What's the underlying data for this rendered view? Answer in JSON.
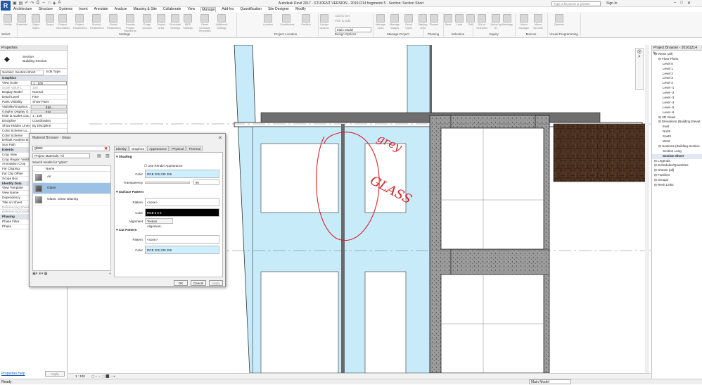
{
  "window": {
    "title": "Autodesk Revit 2017 - STUDENT VERSION -   20161214 fragments 5 - Section: Section Short",
    "search_placeholder": "Type a keyword or phrase",
    "signin": "Sign In"
  },
  "app_button": "R",
  "ribbon": {
    "tabs": [
      "Architecture",
      "Structure",
      "Systems",
      "Insert",
      "Annotate",
      "Analyze",
      "Massing & Site",
      "Collaborate",
      "View",
      "Manage",
      "Add-Ins",
      "Quantification",
      "Site Designer",
      "Modify"
    ],
    "active_tab": "Manage",
    "buttons": [
      "Modify",
      "Materials",
      "Object Styles",
      "Snaps",
      "Project Information",
      "Project Parameters",
      "Shared Parameters",
      "Global Parameters",
      "Transfer Project Standards",
      "Purge Unused",
      "Project Units",
      "Structural Settings",
      "MEP Settings",
      "Panel Schedule Templates",
      "Additional Settings",
      "Location",
      "Coordinates",
      "Position",
      "Design Options",
      "Main Model",
      "Manage Links",
      "Manage Images",
      "Decal Types",
      "Starting View",
      "Phases",
      "Save",
      "Load",
      "Edit",
      "IDs of Selection",
      "Select by ID",
      "Warnings",
      "Macro Manager",
      "Macro Security",
      "Dynamo"
    ],
    "design_option_items": [
      "Add to Set",
      "Pick to Edit",
      "Main Model"
    ],
    "panels": [
      "Select",
      "Settings",
      "Project Location",
      "Design Options",
      "Manage Project",
      "Phasing",
      "Selection",
      "Inquiry",
      "Macros",
      "Visual Programming"
    ]
  },
  "properties": {
    "title": "Properties",
    "type_name": "Section",
    "type_sub": "Building Section",
    "selector": "Section: Section Short",
    "edit_type": "Edit Type",
    "rows": [
      {
        "k": "Graphics",
        "v": "",
        "cat": true
      },
      {
        "k": "View Scale",
        "v": "1 : 100"
      },
      {
        "k": "Scale Value  1:",
        "v": "100",
        "dim": true
      },
      {
        "k": "Display Model",
        "v": "Normal"
      },
      {
        "k": "Detail Level",
        "v": "Fine"
      },
      {
        "k": "Parts Visibility",
        "v": "Show Parts"
      },
      {
        "k": "Visibility/Graphics...",
        "v": "Edit..."
      },
      {
        "k": "Graphic Display O...",
        "v": "Edit..."
      },
      {
        "k": "Hide at scales coa...",
        "v": "1 : 100"
      },
      {
        "k": "Discipline",
        "v": "Coordination"
      },
      {
        "k": "Show Hidden Lines",
        "v": "By Discipline"
      },
      {
        "k": "Color Scheme Lo...",
        "v": ""
      },
      {
        "k": "Color Scheme",
        "v": ""
      },
      {
        "k": "Default Analysis D...",
        "v": ""
      },
      {
        "k": "Sun Path",
        "v": ""
      },
      {
        "k": "Extents",
        "v": "",
        "cat": true
      },
      {
        "k": "Crop View",
        "v": ""
      },
      {
        "k": "Crop Region Visible",
        "v": ""
      },
      {
        "k": "Annotation Crop",
        "v": ""
      },
      {
        "k": "Far Clipping",
        "v": ""
      },
      {
        "k": "Far Clip Offset",
        "v": ""
      },
      {
        "k": "Scope Box",
        "v": ""
      },
      {
        "k": "Identity Data",
        "v": "",
        "cat": true
      },
      {
        "k": "View Template",
        "v": ""
      },
      {
        "k": "View Name",
        "v": ""
      },
      {
        "k": "Dependency",
        "v": ""
      },
      {
        "k": "Title on Sheet",
        "v": ""
      },
      {
        "k": "Referencing Sheet",
        "v": "",
        "dim": true
      },
      {
        "k": "Referencing Detail",
        "v": "",
        "dim": true
      },
      {
        "k": "Phasing",
        "v": "",
        "cat": true
      },
      {
        "k": "Phase Filter",
        "v": ""
      },
      {
        "k": "Phase",
        "v": ""
      }
    ],
    "help_link": "Properties help",
    "apply": "Apply"
  },
  "browser": {
    "title": "Project Browser - 20161214 fr...",
    "items": [
      {
        "t": "Views (all)",
        "d": 0
      },
      {
        "t": "Floor Plans",
        "d": 1
      },
      {
        "t": "Level  0",
        "d": 2
      },
      {
        "t": "Level  1",
        "d": 2
      },
      {
        "t": "Level  2",
        "d": 2
      },
      {
        "t": "Level  3",
        "d": 2
      },
      {
        "t": "Level  4",
        "d": 2
      },
      {
        "t": "Level -1",
        "d": 2
      },
      {
        "t": "Level -2",
        "d": 2
      },
      {
        "t": "Level -3",
        "d": 2
      },
      {
        "t": "Level -4",
        "d": 2
      },
      {
        "t": "Level -5",
        "d": 2
      },
      {
        "t": "Level -6",
        "d": 2
      },
      {
        "t": "3D Views",
        "d": 1
      },
      {
        "t": "Elevations (Building Elevat",
        "d": 1
      },
      {
        "t": "East",
        "d": 2
      },
      {
        "t": "North",
        "d": 2
      },
      {
        "t": "South",
        "d": 2
      },
      {
        "t": "West",
        "d": 2
      },
      {
        "t": "Sections (Building Section",
        "d": 1
      },
      {
        "t": "Section Long",
        "d": 2
      },
      {
        "t": "Section Short",
        "d": 2,
        "sel": true
      },
      {
        "t": "Legends",
        "d": 0
      },
      {
        "t": "Schedules/Quantities",
        "d": 0
      },
      {
        "t": "Sheets (all)",
        "d": 0
      },
      {
        "t": "Families",
        "d": 0
      },
      {
        "t": "Groups",
        "d": 0
      },
      {
        "t": "Revit Links",
        "d": 0
      }
    ]
  },
  "material_browser": {
    "title": "Material Browser - Glass",
    "search_value": "glass",
    "filter": "Project Materials: All",
    "results_label": "Search results for \"glass\"",
    "column": "Name",
    "items": [
      {
        "name": "Air",
        "sel": false
      },
      {
        "name": "Glass",
        "sel": true
      },
      {
        "name": "Glass, Clear Glazing",
        "sel": false
      }
    ],
    "tabs": [
      "Identity",
      "Graphics",
      "Appearance",
      "Physical",
      "Thermal"
    ],
    "active_tab": "Graphics",
    "shading": {
      "title": "Shading",
      "use_render": "Use Render Appearance",
      "color_label": "Color",
      "color_value": "RGB 206 239 255",
      "transparency_label": "Transparency",
      "transparency_value": "90",
      "color_hex": "#ceefff"
    },
    "surface": {
      "title": "Surface Pattern",
      "pattern_label": "Pattern",
      "pattern_value": "<none>",
      "color_label": "Color",
      "color_value": "RGB 0 0 0",
      "alignment_label": "Alignment",
      "alignment_btn": "Texture Alignment..."
    },
    "cut": {
      "title": "Cut Pattern",
      "pattern_label": "Pattern",
      "pattern_value": "<none>",
      "color_label": "Color",
      "color_value": "RGB 206 239 255"
    },
    "buttons": {
      "ok": "OK",
      "cancel": "Cancel",
      "apply": "Apply"
    }
  },
  "canvas": {
    "view_scale": "1 : 100",
    "annotations": [
      "grey",
      "GLASS"
    ]
  },
  "status": {
    "ready": "Ready",
    "model": "Main Model"
  },
  "colors": {
    "glass": "#c8ebfa",
    "concrete": "#8f8f8f",
    "brick": "#4a3020",
    "ink": "#d8232a"
  }
}
